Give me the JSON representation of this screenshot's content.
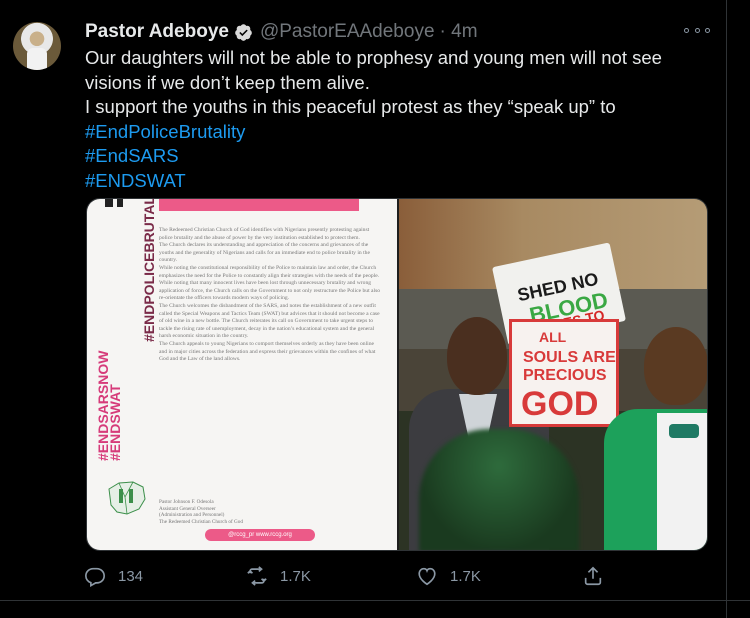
{
  "tweet": {
    "display_name": "Pastor Adeboye",
    "handle": "@PastorEAAdeboye",
    "time": "· 4m",
    "lines": [
      "Our daughters will not be able to prophesy and young men will not see",
      "visions if we don’t keep them alive.",
      "I support the youths in this peaceful protest as they “speak up” to"
    ],
    "hashtags": [
      "#EndPoliceBrutality",
      "#EndSARS",
      "#ENDSWAT"
    ]
  },
  "media": {
    "document": {
      "vertical_hashtags": [
        "#ENDSARSNOW",
        "#ENDSWAT",
        "#ENDPOLICEBRUTALITYNIGERIA"
      ],
      "paragraphs": [
        "The Redeemed Christian Church of God identifies with Nigerians presently protesting against police brutality and the abuse of power by the very institution established to protect them.",
        "The Church declares its understanding and appreciation of the concerns and grievances of the youths and the generality of Nigerians and calls for an immediate end to police brutality in the country.",
        "While noting the constitutional responsibility of the Police to maintain law and order, the Church emphasizes the need for the Police to constantly align their strategies with the needs of the people. While noting that many innocent lives have been lost through unnecessary brutality and wrong application of force, the Church calls on the Government to not only restructure the Police but also re-orientate the officers towards modern ways of policing.",
        "The Church welcomes the disbandment of the SARS, and notes the establishment of a new outfit called the Special Weapons and Tactics Team (SWAT) but advices that it should not become a case of old wine in a new bottle. The Church reiterates its call on Government to take urgent steps to tackle the rising rate of unemployment, decay in the nation’s educational system and the general harsh economic situation in the country.",
        "The Church appeals to young Nigerians to comport themselves orderly as they have been online and in major cities across the federation and express their grievances within the confines of what God and the Law of the land allows."
      ],
      "signature": [
        "Pastor Johnson F. Odesola",
        "Assistant General Overseer",
        "(Administration and Personnel)",
        "The Redeemed Christian Church of God"
      ],
      "footer": "@rccg_pr   www.rccg.org"
    },
    "photo": {
      "sign_white": [
        "SHED NO",
        "BLOOD",
        "IT CRIES TO"
      ],
      "sign_red": [
        "ALL",
        "SOULS ARE",
        "PRECIOUS",
        "GOD"
      ]
    }
  },
  "actions": {
    "reply_count": "134",
    "retweet_count": "1.7K",
    "like_count": "1.7K"
  },
  "colors": {
    "link": "#1d9bf0",
    "verified": "#d9d9d9",
    "muted": "#71767b"
  }
}
